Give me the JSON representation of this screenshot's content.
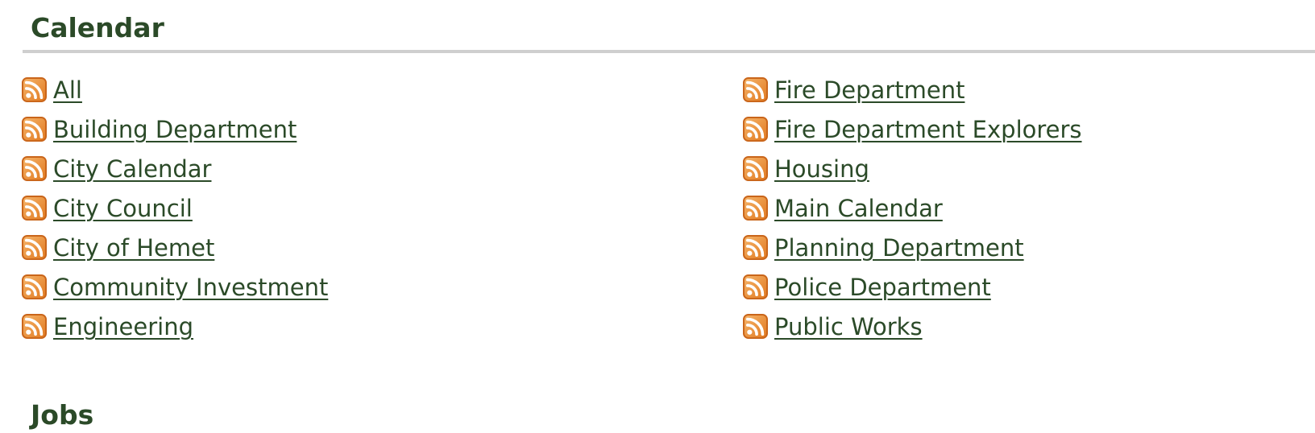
{
  "sections": [
    {
      "heading": "Calendar",
      "left_column": [
        {
          "label": "All",
          "icon": "rss-feed-icon"
        },
        {
          "label": "Building Department",
          "icon": "rss-feed-icon"
        },
        {
          "label": "City Calendar",
          "icon": "rss-feed-icon"
        },
        {
          "label": "City Council",
          "icon": "rss-feed-icon"
        },
        {
          "label": "City of Hemet",
          "icon": "rss-feed-icon"
        },
        {
          "label": "Community Investment",
          "icon": "rss-feed-icon"
        },
        {
          "label": "Engineering",
          "icon": "rss-feed-icon"
        }
      ],
      "right_column": [
        {
          "label": "Fire Department",
          "icon": "rss-feed-icon"
        },
        {
          "label": "Fire Department Explorers",
          "icon": "rss-feed-icon"
        },
        {
          "label": "Housing",
          "icon": "rss-feed-icon"
        },
        {
          "label": "Main Calendar",
          "icon": "rss-feed-icon"
        },
        {
          "label": "Planning Department",
          "icon": "rss-feed-icon"
        },
        {
          "label": "Police Department",
          "icon": "rss-feed-icon"
        },
        {
          "label": "Public Works",
          "icon": "rss-feed-icon"
        }
      ]
    },
    {
      "heading": "Jobs"
    }
  ],
  "colors": {
    "text": "#2b4a28",
    "rule": "#cfcfcf",
    "rss_icon_light": "#f6b56a",
    "rss_icon_dark": "#e0781f"
  }
}
